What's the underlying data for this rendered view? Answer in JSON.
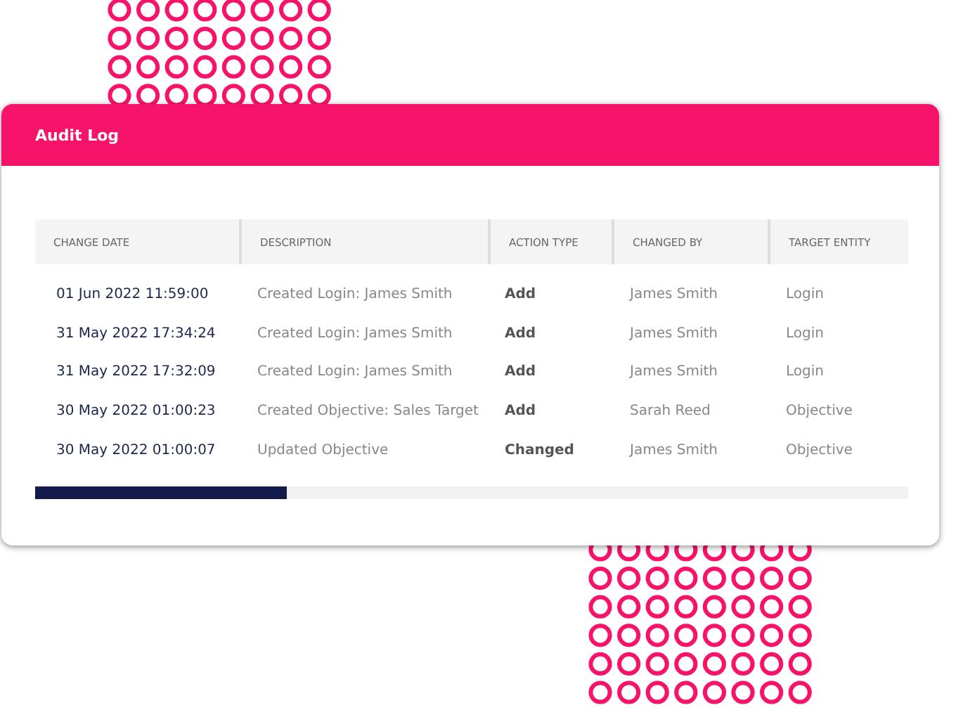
{
  "panel": {
    "title": "Audit Log"
  },
  "table": {
    "columns": [
      "CHANGE DATE",
      "DESCRIPTION",
      "ACTION TYPE",
      "CHANGED BY",
      "TARGET ENTITY"
    ],
    "rows": [
      [
        "01 Jun 2022 11:59:00",
        "Created Login: James Smith",
        "Add",
        "James Smith",
        "Login"
      ],
      [
        "31 May 2022 17:34:24",
        "Created Login: James Smith",
        "Add",
        "James Smith",
        "Login"
      ],
      [
        "31 May 2022 17:32:09",
        "Created Login: James Smith",
        "Add",
        "James Smith",
        "Login"
      ],
      [
        "30 May 2022 01:00:23",
        "Created Objective: Sales Target",
        "Add",
        "Sarah Reed",
        "Objective"
      ],
      [
        "30 May 2022 01:00:07",
        "Updated Objective",
        "Changed",
        "James Smith",
        "Objective"
      ]
    ]
  }
}
